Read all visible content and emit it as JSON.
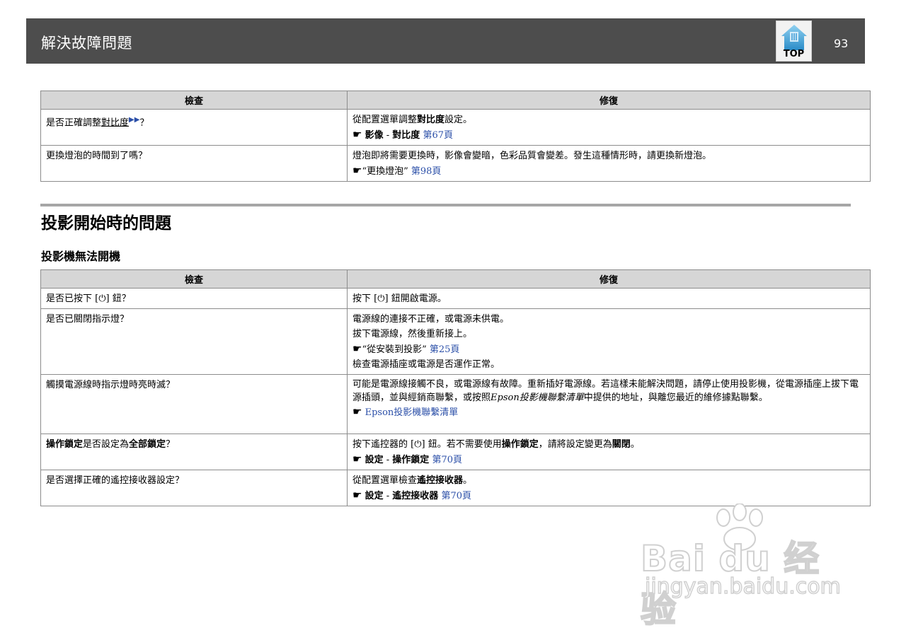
{
  "header": {
    "title": "解決故障問題",
    "top_label": "TOP",
    "page_number": "93"
  },
  "table1": {
    "col_check": "檢查",
    "col_fix": "修復",
    "rows": [
      {
        "check": {
          "a": "是否正確調整",
          "b": "對比度",
          "c": "？"
        },
        "fix": [
          {
            "a": "從配置選單調整",
            "b": "對比度",
            "c": "設定。"
          },
          {
            "hand": "☛",
            "a": "影像",
            "b": " - ",
            "c": "對比度",
            "link": "第67頁"
          }
        ]
      },
      {
        "check": "更換燈泡的時間到了嗎？",
        "fix": [
          "燈泡即將需要更換時，影像會變暗，色彩品質會變差。發生這種情形時，請更換新燈泡。",
          {
            "hand": "☛",
            "text": "“更換燈泡”",
            "link": "第98頁"
          }
        ]
      }
    ]
  },
  "section": {
    "title": "投影開始時的問題",
    "subtitle": "投影機無法開機"
  },
  "table2": {
    "col_check": "檢查",
    "col_fix": "修復",
    "rows": [
      {
        "check": "是否已按下 [⏻] 鈕？",
        "fix": [
          "按下 [⏻] 鈕開啟電源。"
        ]
      },
      {
        "check": "是否已關閉指示燈？",
        "fix": [
          "電源線的連接不正確，或電源未供電。",
          "拔下電源線，然後重新接上。",
          {
            "hand": "☛",
            "text": "“從安裝到投影”",
            "link": "第25頁"
          },
          "檢查電源插座或電源是否運作正常。"
        ]
      },
      {
        "check": "觸摸電源線時指示燈時亮時滅？",
        "fix": [
          {
            "a": "可能是電源線接觸不良，或電源線有故障。重新插好電源線。若這樣未能解決問題，請停止使用投影機，從電源插座上拔下電源插頭，並與經銷商聯繫，或按照",
            "b": "Epson投影機聯繫清單",
            "c": "中提供的地址，與離您最近的維修據點聯繫。"
          },
          {
            "hand": "☛",
            "link": "Epson投影機聯繫清單"
          }
        ]
      },
      {
        "check": {
          "a": "操作鎖定",
          "b": "是否設定為",
          "c": "全部鎖定",
          "d": "？"
        },
        "fix": [
          {
            "a": "按下遙控器的 [⏻] 鈕。若不需要使用",
            "b": "操作鎖定",
            "c": "，請將設定變更為",
            "d": "關閉",
            "e": "。"
          },
          {
            "hand": "☛",
            "a": "設定",
            "b": " - ",
            "c": "操作鎖定",
            "link": "第70頁"
          }
        ]
      },
      {
        "check": "是否選擇正確的遙控接收器設定？",
        "fix": [
          {
            "a": "從配置選單檢查",
            "b": "遙控接收器",
            "c": "。"
          },
          {
            "hand": "☛",
            "a": "設定",
            "b": " - ",
            "c": "遙控接收器",
            "link": "第70頁"
          }
        ]
      }
    ]
  },
  "watermark": {
    "brand": "Bai du 经验",
    "url": "jingyan.baidu.com"
  }
}
